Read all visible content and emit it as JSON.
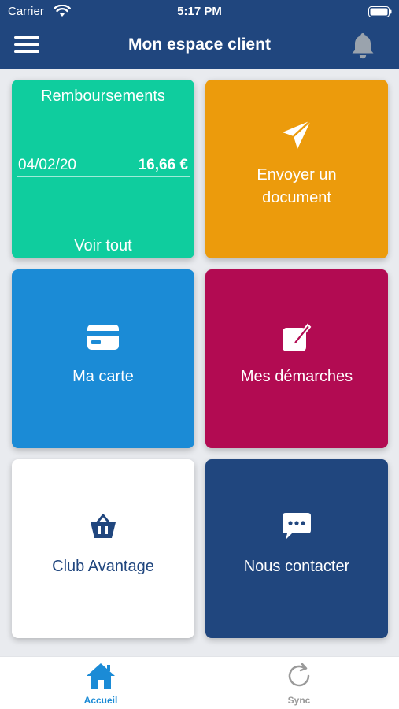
{
  "status_bar": {
    "carrier": "Carrier",
    "time": "5:17 PM"
  },
  "header": {
    "title": "Mon espace client"
  },
  "tiles": {
    "reimbursements": {
      "title": "Remboursements",
      "entry_date": "04/02/20",
      "entry_amount": "16,66 €",
      "see_all": "Voir tout"
    },
    "send_document": {
      "label_line1": "Envoyer un",
      "label_line2": "document",
      "icon": "paper-plane-icon"
    },
    "my_card": {
      "label": "Ma carte",
      "icon": "credit-card-icon"
    },
    "my_procedures": {
      "label": "Mes démarches",
      "icon": "edit-note-icon"
    },
    "club": {
      "label": "Club Avantage",
      "icon": "basket-icon"
    },
    "contact": {
      "label": "Nous contacter",
      "icon": "chat-bubble-icon"
    }
  },
  "tab_bar": {
    "items": [
      {
        "label": "Accueil",
        "icon": "home-icon",
        "active": true
      },
      {
        "label": "Sync",
        "icon": "sync-icon",
        "active": false
      }
    ]
  },
  "colors": {
    "navy": "#20467e",
    "green": "#0fcd9e",
    "orange": "#ec9b0c",
    "blue": "#1b8bd6",
    "magenta": "#b20b52",
    "white": "#ffffff"
  }
}
